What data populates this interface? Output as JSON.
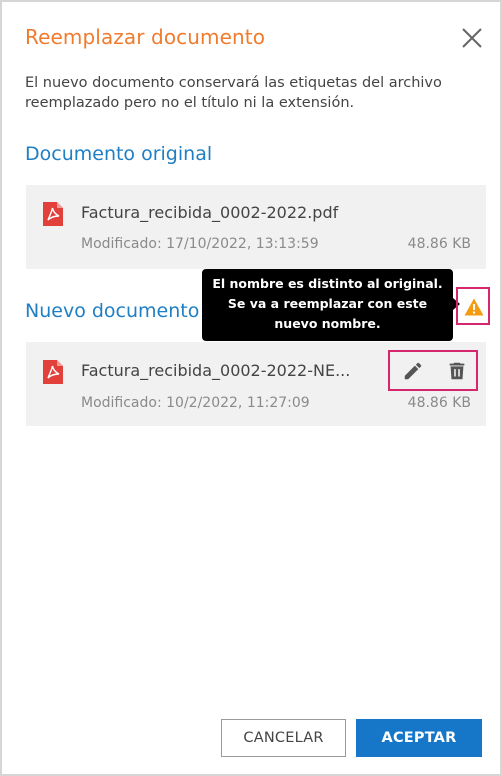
{
  "dialog": {
    "title": "Reemplazar documento",
    "description": "El nuevo documento conservará las etiquetas del archivo reemplazado pero no el título ni la extensión."
  },
  "original": {
    "heading": "Documento original",
    "file_name": "Factura_recibida_0002-2022.pdf",
    "modified": "Modificado: 17/10/2022, 13:13:59",
    "size": "48.86 KB",
    "icon": "pdf-icon"
  },
  "new_doc": {
    "heading": "Nuevo documento",
    "file_name": "Factura_recibida_0002-2022-NE...",
    "modified": "Modificado: 10/2/2022, 11:27:09",
    "size": "48.86 KB",
    "icon": "pdf-icon",
    "actions": [
      "pencil-icon",
      "trash-icon"
    ]
  },
  "tooltip": {
    "text": "El nombre es distinto al original. Se va a reemplazar con este nuevo nombre."
  },
  "buttons": {
    "cancel": "CANCELAR",
    "accept": "ACEPTAR"
  },
  "colors": {
    "title": "#f07b2d",
    "heading": "#1f7fc4",
    "accent": "#1677c9",
    "highlight": "#d6266d",
    "warning": "#f39c12",
    "pdf": "#e2413b"
  }
}
